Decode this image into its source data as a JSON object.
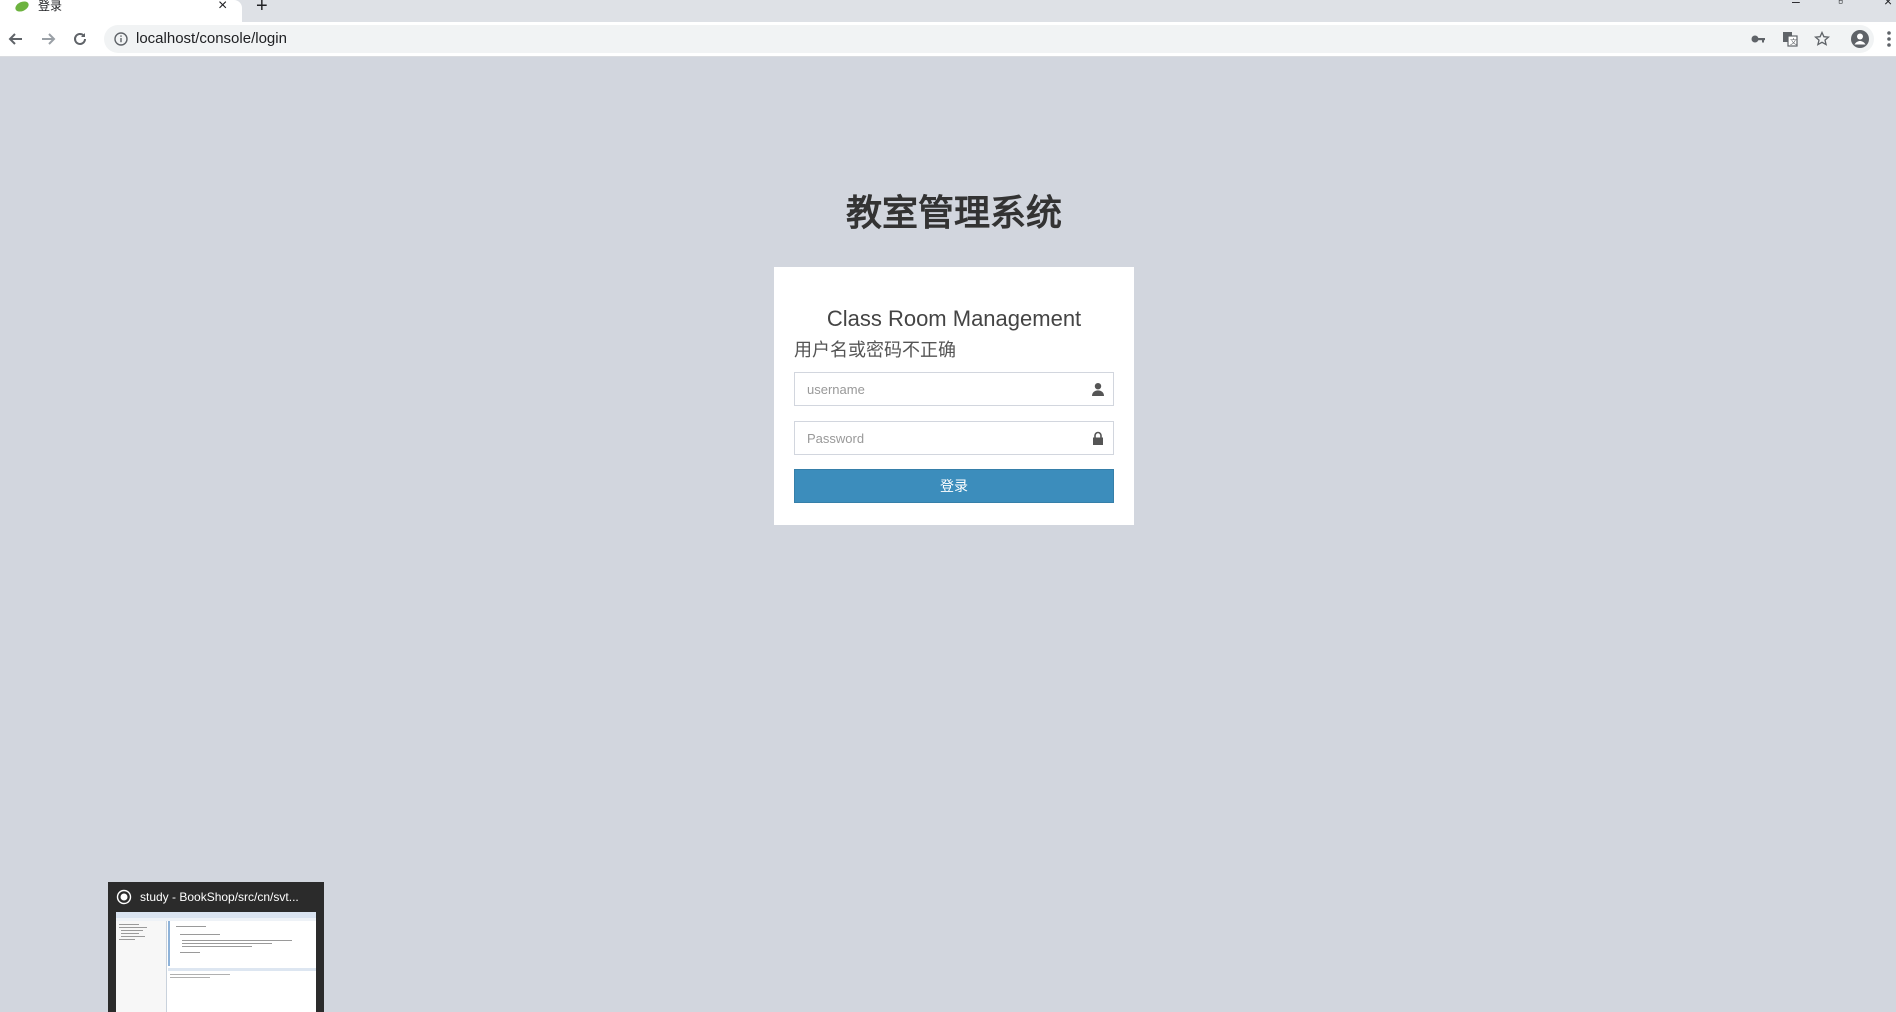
{
  "browser": {
    "tab_title": "登录",
    "tab_close": "×",
    "new_tab": "+",
    "url": "localhost/console/login",
    "icons": {
      "back": "back-arrow-icon",
      "forward": "forward-arrow-icon",
      "reload": "reload-icon",
      "info": "info-icon",
      "key": "key-icon",
      "translate": "translate-icon",
      "bookmark": "star-icon",
      "profile": "account-icon",
      "menu": "kebab-menu-icon"
    }
  },
  "page": {
    "title": "教室管理系统",
    "box_heading": "Class Room Management",
    "error_message": "用户名或密码不正确",
    "username_placeholder": "username",
    "password_placeholder": "Password",
    "login_button": "登录"
  },
  "taskbar_thumbnail": {
    "title": "study - BookShop/src/cn/svt..."
  },
  "colors": {
    "page_background": "#d2d6de",
    "button_primary": "#3c8dbc",
    "title_text": "#333333"
  }
}
